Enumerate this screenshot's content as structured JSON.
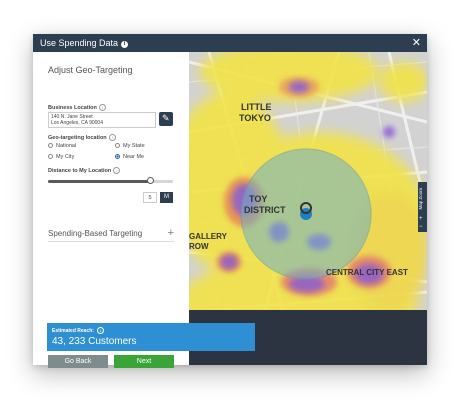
{
  "window": {
    "title": "Use Spending Data",
    "info_icon": "info-icon",
    "close_icon": "close-icon",
    "close_label": "✕"
  },
  "panel": {
    "heading": "Adjust Geo-Targeting",
    "business_location": {
      "label": "Business Location",
      "value_line1": "140 N. Jane Street",
      "value_line2": "Los Angeles, CA 90004",
      "edit_icon": "edit-icon"
    },
    "geo_targeting": {
      "label": "Geo-targeting location",
      "options": [
        {
          "label": "National",
          "selected": false
        },
        {
          "label": "My State",
          "selected": false
        },
        {
          "label": "My City",
          "selected": false
        },
        {
          "label": "Near Me",
          "selected": true
        }
      ]
    },
    "distance": {
      "label": "Distance to My Location",
      "slider_fraction": 0.82,
      "value": "5",
      "unit": "M"
    },
    "spending_section": {
      "label": "Spending-Based Targeting",
      "expand_icon": "plus-icon",
      "expand_glyph": "+"
    },
    "buttons": {
      "back": "Go Back",
      "next": "Next"
    }
  },
  "map": {
    "labels": [
      "LITTLE",
      "TOKYO",
      "TOY",
      "DISTRICT",
      "GALLERY",
      "ROW",
      "CENTRAL CITY EAST"
    ],
    "zoom": {
      "label": "Map Zoom",
      "plus": "+",
      "minus": "−"
    },
    "reach": {
      "caption": "Estimated Reach:",
      "value": "43, 233 Customers"
    },
    "colors": {
      "heat_yellow": "#f2e34a",
      "heat_purple": "#8a5fd0",
      "radius_fill": "#6fb0c9",
      "pin": "#1f7fc4"
    }
  }
}
